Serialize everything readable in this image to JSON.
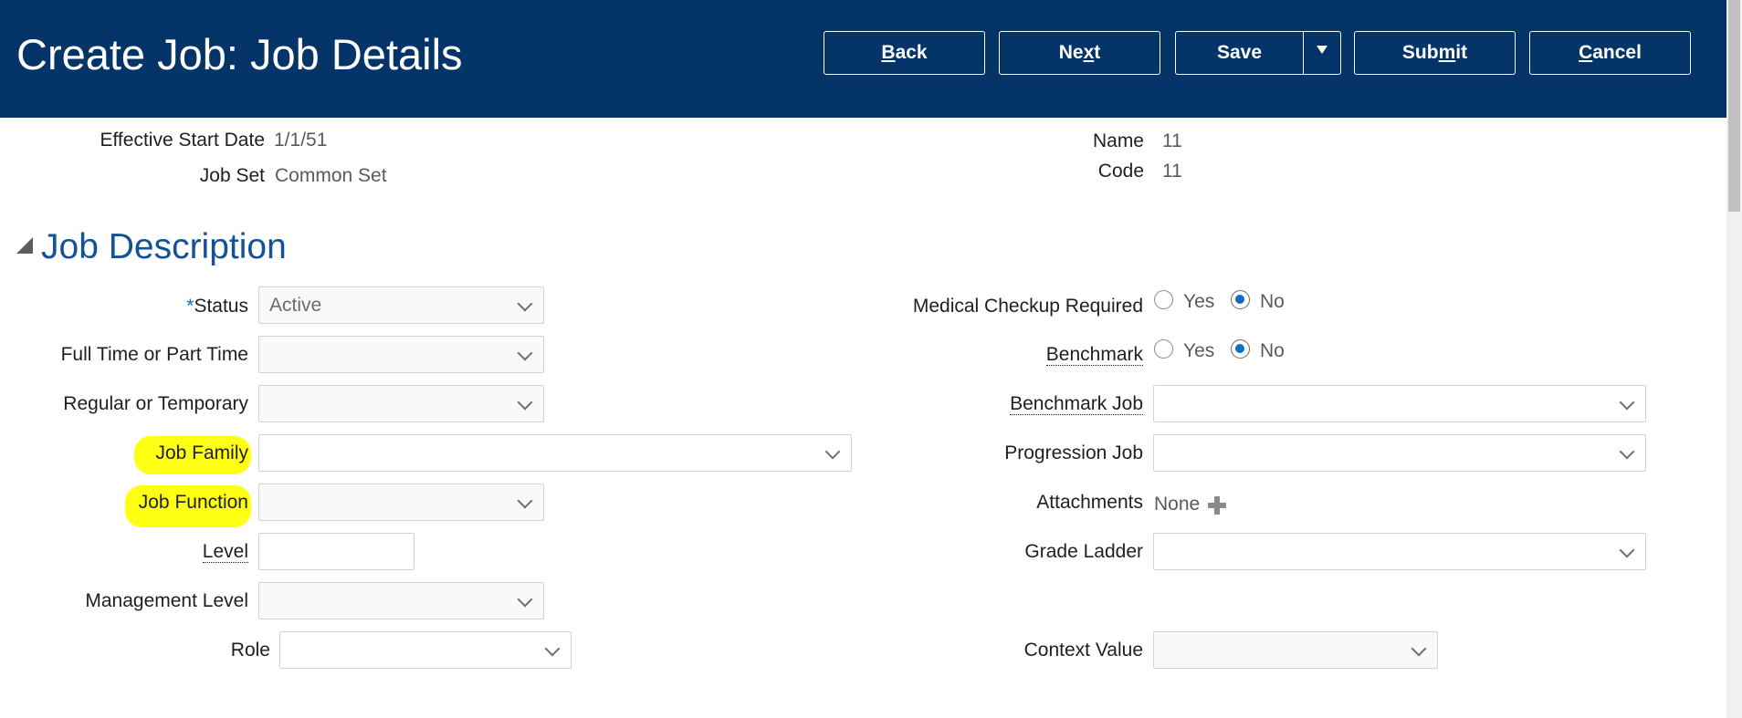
{
  "header": {
    "title": "Create Job: Job Details",
    "buttons": {
      "back": {
        "pre": "",
        "ul": "B",
        "post": "ack"
      },
      "next": {
        "pre": "Ne",
        "ul": "x",
        "post": "t"
      },
      "save": "Save",
      "submit": {
        "pre": "Sub",
        "ul": "m",
        "post": "it"
      },
      "cancel": {
        "pre": "",
        "ul": "C",
        "post": "ancel"
      }
    }
  },
  "summary": {
    "effective_start_date_label": "Effective Start Date",
    "effective_start_date_value": "1/1/51",
    "job_set_label": "Job Set",
    "job_set_value": "Common Set",
    "name_label": "Name",
    "name_value": "11",
    "code_label": "Code",
    "code_value": "11"
  },
  "section": {
    "title": "Job Description"
  },
  "left_fields": {
    "status_required_mark": "*",
    "status_label": "Status",
    "status_value": "Active",
    "full_part_label": "Full Time or Part Time",
    "regular_temp_label": "Regular or Temporary",
    "job_family_label": "Job Family",
    "job_function_label": "Job Function",
    "level_label": "Level",
    "management_level_label": "Management Level",
    "role_label": "Role"
  },
  "right_fields": {
    "medical_label": "Medical Checkup Required",
    "benchmark_label": "Benchmark",
    "yes": "Yes",
    "no": "No",
    "medical_selected": "No",
    "benchmark_selected": "No",
    "benchmark_job_label": "Benchmark Job",
    "progression_job_label": "Progression Job",
    "attachments_label": "Attachments",
    "attachments_value": "None",
    "grade_ladder_label": "Grade Ladder",
    "context_value_label": "Context Value"
  },
  "icons": {
    "dropdown": "chevron-down-icon",
    "add": "plus-icon",
    "split": "triangle-down-icon",
    "collapse": "triangle-collapse-icon"
  },
  "colors": {
    "header_bg": "#043468",
    "section_title": "#135296",
    "required": "#0b6fc1",
    "highlight": "#ffff14",
    "radio_selected": "#0b6fc1"
  }
}
